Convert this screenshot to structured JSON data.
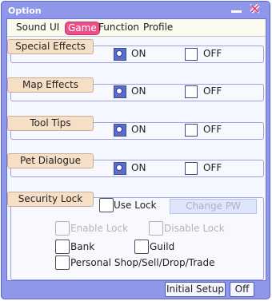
{
  "window": {
    "title": "Option"
  },
  "tabs": [
    {
      "label": "Sound"
    },
    {
      "label": "UI"
    },
    {
      "label": "Game",
      "active": true
    },
    {
      "label": "Function"
    },
    {
      "label": "Profile"
    }
  ],
  "settings": [
    {
      "label": "Special Effects",
      "on_label": "ON",
      "off_label": "OFF",
      "value": "ON"
    },
    {
      "label": "Map Effects",
      "on_label": "ON",
      "off_label": "OFF",
      "value": "ON"
    },
    {
      "label": "Tool Tips",
      "on_label": "ON",
      "off_label": "OFF",
      "value": "ON"
    },
    {
      "label": "Pet Dialogue",
      "on_label": "ON",
      "off_label": "OFF",
      "value": "ON"
    }
  ],
  "security": {
    "label": "Security Lock",
    "use_lock_label": "Use Lock",
    "use_lock_checked": false,
    "change_pw_label": "Change PW",
    "enable_lock_label": "Enable Lock",
    "disable_lock_label": "Disable Lock",
    "bank_label": "Bank",
    "guild_label": "Guild",
    "shop_label": "Personal Shop/Sell/Drop/Trade"
  },
  "footer": {
    "initial_setup_label": "Initial Setup",
    "off_label": "Off"
  },
  "colors": {
    "frame": "#8e97ea",
    "active_tab": "#ec4f8b",
    "label_pill": "#f6dfc6",
    "panel": "#f4f7ff"
  },
  "icons": {
    "minimize": "minimize-icon",
    "close": "close-icon"
  }
}
